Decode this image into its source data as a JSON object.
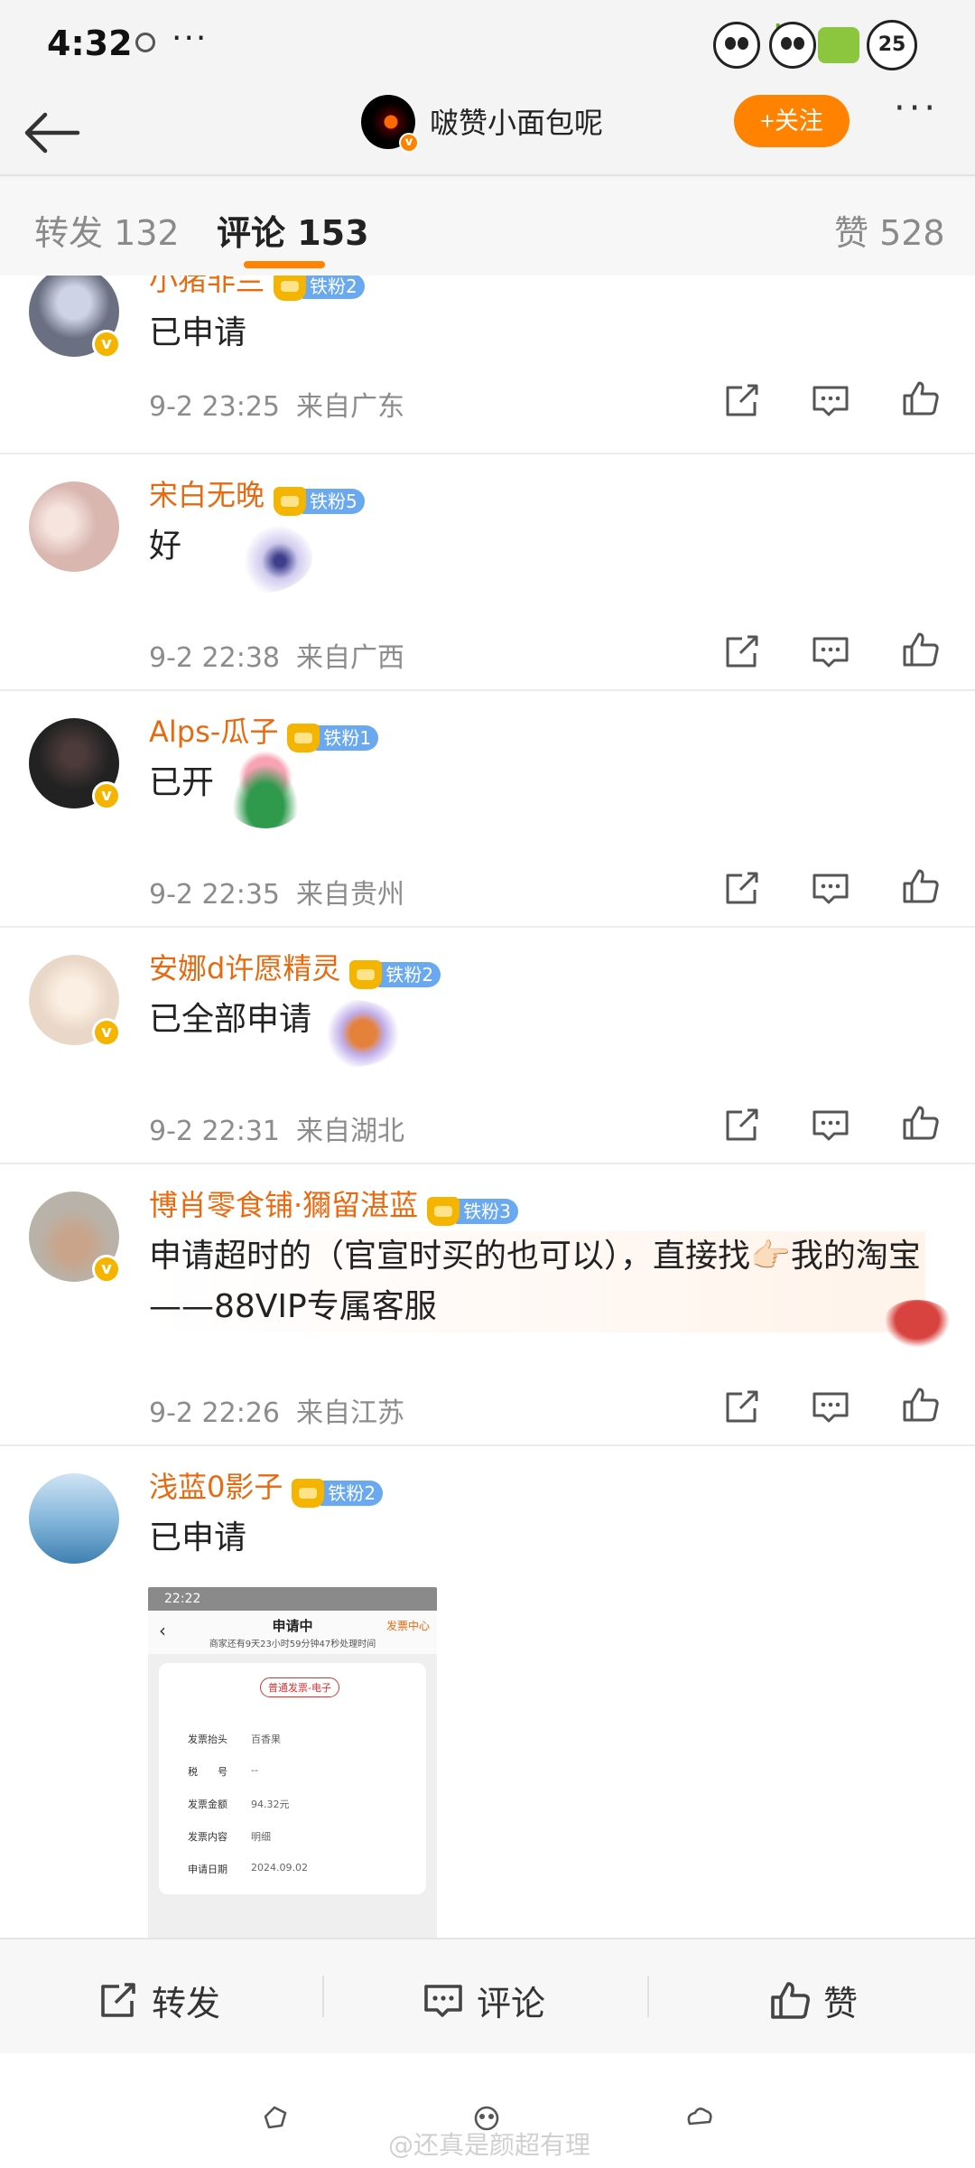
{
  "status_bar": {
    "time": "4:32",
    "dots": "···",
    "network_label": "HD",
    "battery": "25"
  },
  "header": {
    "back_label": "返回",
    "title": "啵赞小面包呢",
    "follow_label": "+关注",
    "more_label": "···"
  },
  "tabs": [
    {
      "label": "转发 132"
    },
    {
      "label": "评论 153"
    },
    {
      "label": "赞 528"
    }
  ],
  "comments": [
    {
      "user": "小猪非兰",
      "fan_badge": "铁粉2",
      "text": "已申请",
      "date": "9-2 23:25",
      "location": "来自广东",
      "avatar_color": "#6b6f82"
    },
    {
      "user": "宋白无晚",
      "fan_badge": "铁粉5",
      "text": "好",
      "date": "9-2 22:38",
      "location": "来自广西",
      "avatar_color": "#d9b6b0"
    },
    {
      "user": "Alps-瓜子",
      "fan_badge": "铁粉1",
      "text": "已开",
      "date": "9-2 22:35",
      "location": "来自贵州",
      "avatar_color": "#2a2a2a"
    },
    {
      "user": "安娜d许愿精灵",
      "fan_badge": "铁粉2",
      "text": "已全部申请",
      "date": "9-2 22:31",
      "location": "来自湖北",
      "avatar_color": "#e9d8c8"
    },
    {
      "user": "博肖零食铺·獮留湛蓝",
      "fan_badge": "铁粉3",
      "text": "申请超时的（官宣时买的也可以），直接找👉🏻我的淘宝——88VIP专属客服",
      "date": "9-2 22:26",
      "location": "来自江苏",
      "avatar_color": "#b9b2a8"
    },
    {
      "user": "浅蓝0影子",
      "fan_badge": "铁粉2",
      "text": "已申请",
      "avatar_color": "#7fb3d9"
    }
  ],
  "attachment": {
    "status_time": "22:22",
    "title": "申请中",
    "subtitle": "商家还有9天23小时59分钟47秒处理时间",
    "link": "发票中心",
    "pill": "普通发票-电子",
    "rows": [
      {
        "label": "发票抬头",
        "value": "百香果"
      },
      {
        "label": "税　　号",
        "value": "--"
      },
      {
        "label": "发票金额",
        "value": "94.32元"
      },
      {
        "label": "发票内容",
        "value": "明细"
      },
      {
        "label": "申请日期",
        "value": "2024.09.02"
      }
    ]
  },
  "bottom_bar": {
    "repost": "转发",
    "comment": "评论",
    "like": "赞"
  },
  "watermark": "@还真是颜超有理",
  "colors": {
    "accent": "#ff8200",
    "username": "#e86a10",
    "fan_badge": "#6aa8f0"
  }
}
